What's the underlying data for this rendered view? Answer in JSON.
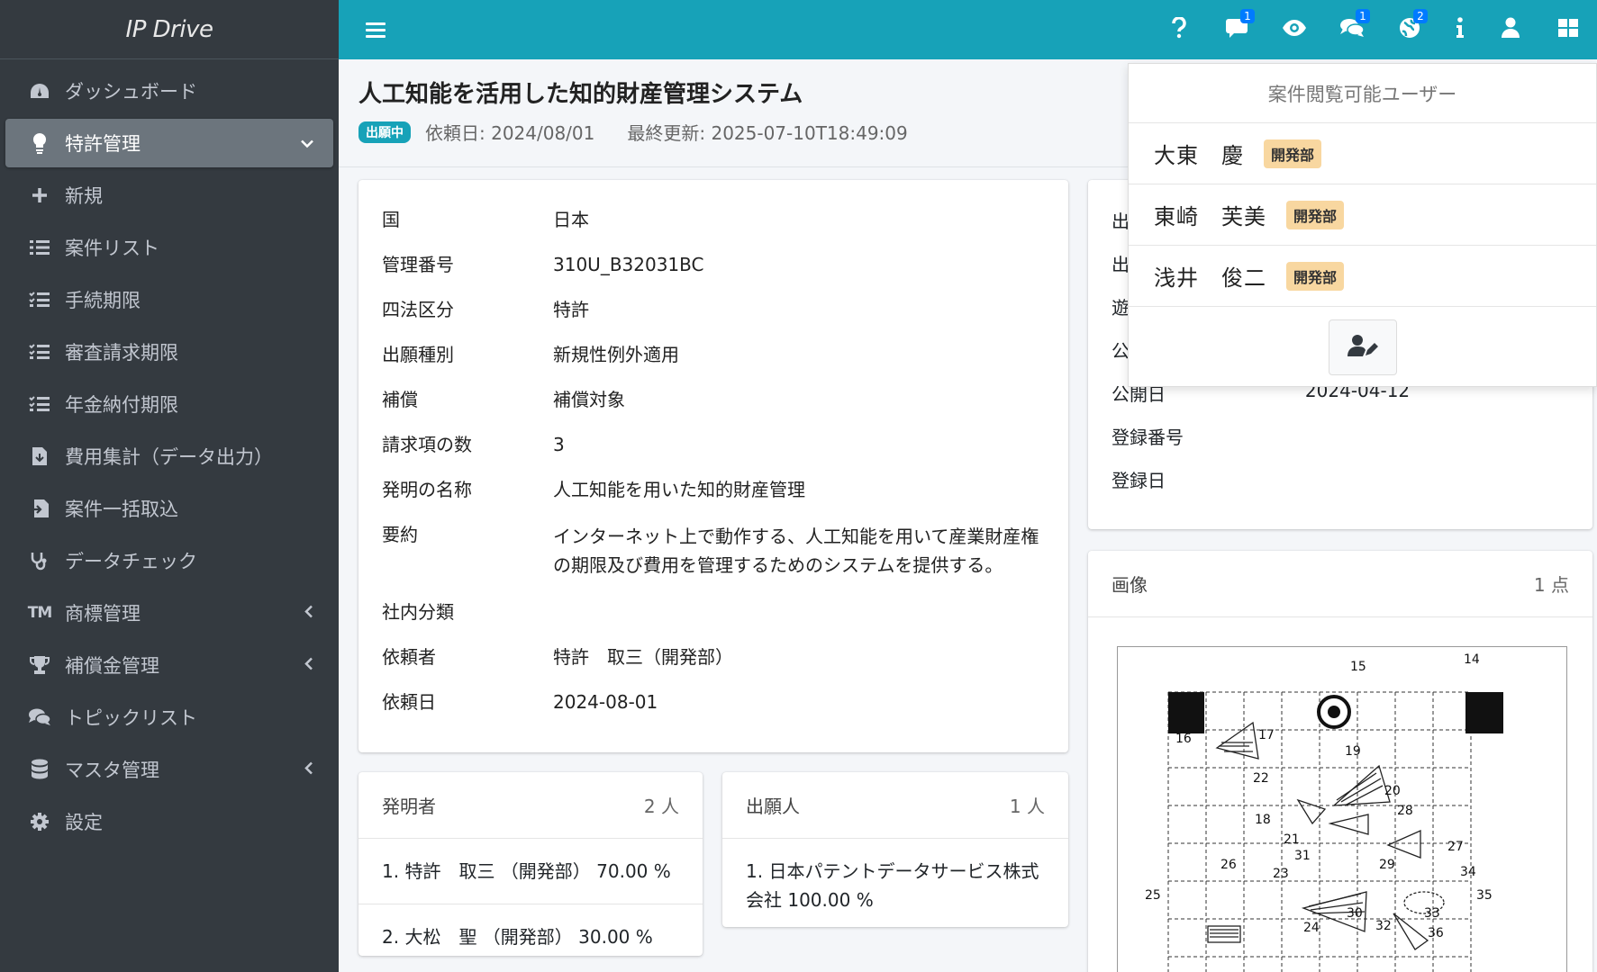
{
  "brand": "IP Drive",
  "sidebar": {
    "items": [
      {
        "label": "ダッシュボード"
      },
      {
        "label": "特許管理"
      },
      {
        "label": "新規"
      },
      {
        "label": "案件リスト"
      },
      {
        "label": "手続期限"
      },
      {
        "label": "審査請求期限"
      },
      {
        "label": "年金納付期限"
      },
      {
        "label": "費用集計（データ出力）"
      },
      {
        "label": "案件一括取込"
      },
      {
        "label": "データチェック"
      },
      {
        "label": "商標管理",
        "tm_mark": "TM"
      },
      {
        "label": "補償金管理"
      },
      {
        "label": "トピックリスト"
      },
      {
        "label": "マスタ管理"
      },
      {
        "label": "設定"
      }
    ]
  },
  "topbar": {
    "comment_badge": "1",
    "chat_badge": "1",
    "globe_badge": "2",
    "accent": "#17a2b8"
  },
  "header": {
    "title": "人工知能を活用した知的財産管理システム",
    "status": "出願中",
    "request_date": "依頼日: 2024/08/01",
    "last_updated": "最終更新: 2025-07-10T18:49:09"
  },
  "details": {
    "rows": [
      {
        "key": "国",
        "value": "日本"
      },
      {
        "key": "管理番号",
        "value": "310U_B32031BC"
      },
      {
        "key": "四法区分",
        "value": "特許"
      },
      {
        "key": "出願種別",
        "value": "新規性例外適用"
      },
      {
        "key": "補償",
        "value": "補償対象"
      },
      {
        "key": "請求項の数",
        "value": "3"
      },
      {
        "key": "発明の名称",
        "value": "人工知能を用いた知的財産管理"
      },
      {
        "key": "要約",
        "value": "インターネット上で動作する、人工知能を用いて産業財産権の期限及び費用を管理するためのシステムを提供する。"
      },
      {
        "key": "社内分類",
        "value": ""
      },
      {
        "key": "依頼者",
        "value": "特許　取三（開発部）"
      },
      {
        "key": "依頼日",
        "value": "2024-08-01"
      }
    ]
  },
  "right_card": {
    "rows": [
      {
        "key": "出",
        "value": ""
      },
      {
        "key": "出",
        "value": ""
      },
      {
        "key": "遊",
        "value": ""
      },
      {
        "key": "公",
        "value": ""
      },
      {
        "key": "公開日",
        "value": "2024-04-12"
      },
      {
        "key": "登録番号",
        "value": ""
      },
      {
        "key": "登録日",
        "value": ""
      }
    ]
  },
  "images": {
    "title": "画像",
    "count": "1 点"
  },
  "inventors": {
    "title": "発明者",
    "count": "2 人",
    "items": [
      "1. 特許　取三 （開発部） 70.00 %",
      "2. 大松　聖 （開発部） 30.00 %"
    ]
  },
  "applicants": {
    "title": "出願人",
    "count": "1 人",
    "items": [
      "1. 日本パテントデータサービス株式会社 100.00 %"
    ]
  },
  "viewers_dropdown": {
    "title": "案件閲覧可能ユーザー",
    "users": [
      {
        "name": "大東　慶",
        "dept": "開発部"
      },
      {
        "name": "東崎　芙美",
        "dept": "開発部"
      },
      {
        "name": "浅井　俊二",
        "dept": "開発部"
      }
    ]
  },
  "figure_labels": [
    "15",
    "14",
    "16",
    "17",
    "19",
    "22",
    "20",
    "18",
    "28",
    "21",
    "27",
    "31",
    "29",
    "26",
    "23",
    "34",
    "25",
    "35",
    "30",
    "33",
    "24",
    "32",
    "36"
  ]
}
